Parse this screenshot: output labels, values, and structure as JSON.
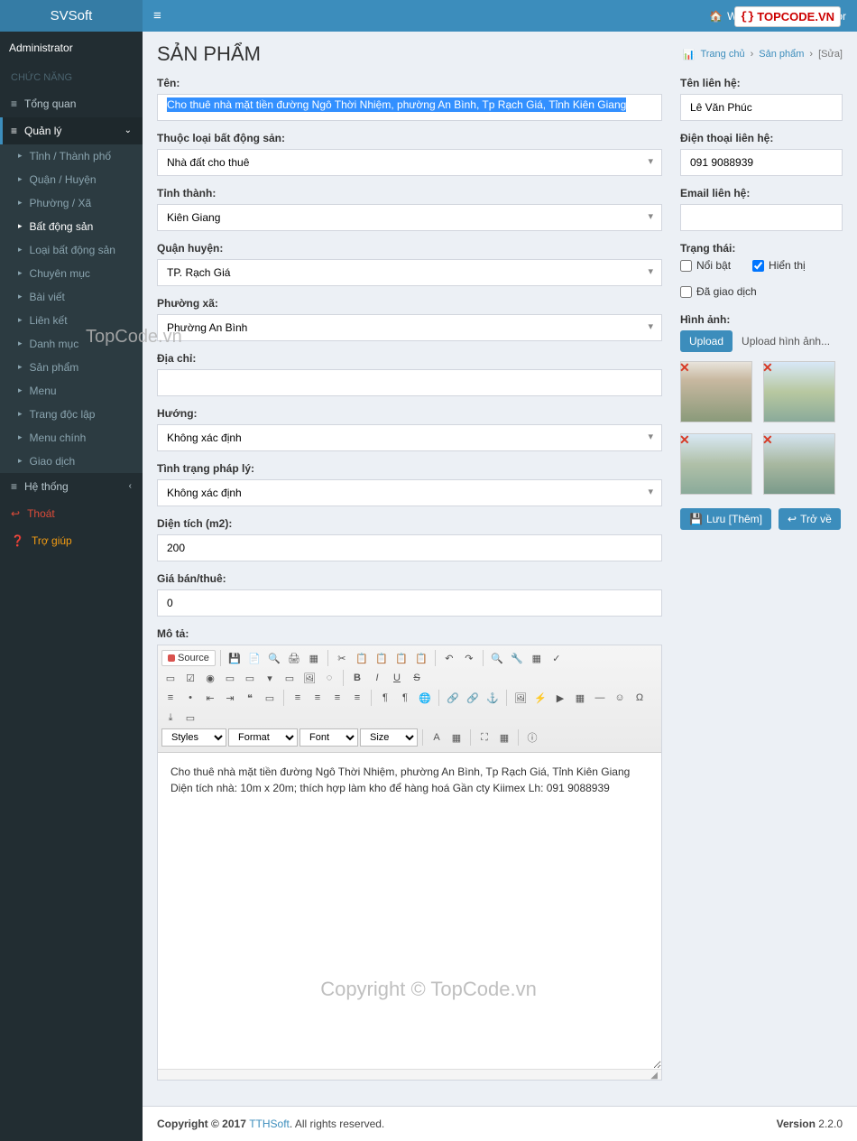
{
  "brand": "SVSoft",
  "header": {
    "website": "Website",
    "user": "Administrator"
  },
  "user_panel": {
    "name": "Administrator"
  },
  "sidebar": {
    "section": "CHỨC NĂNG",
    "overview": "Tổng quan",
    "manage": "Quản lý",
    "tree": {
      "tinh": "Tỉnh / Thành phố",
      "quan": "Quận / Huyện",
      "phuong": "Phường / Xã",
      "bds": "Bất động sản",
      "loaibds": "Loại bất động sản",
      "chuyenmuc": "Chuyên mục",
      "baiviet": "Bài viết",
      "lienket": "Liên kết",
      "danhmuc": "Danh mục",
      "sanpham": "Sản phẩm",
      "menu": "Menu",
      "trangdoclap": "Trang độc lập",
      "menuchinh": "Menu chính",
      "giaodich": "Giao dịch"
    },
    "system": "Hệ thống",
    "logout": "Thoát",
    "help": "Trợ giúp"
  },
  "page": {
    "title": "SẢN PHẨM",
    "breadcrumb": {
      "home": "Trang chủ",
      "sp": "Sản phẩm",
      "edit": "[Sửa]"
    }
  },
  "form": {
    "ten_label": "Tên:",
    "ten_value": "Cho thuê nhà mặt tiền đường Ngô Thời Nhiệm, phường An Bình, Tp Rạch Giá, Tỉnh Kiên Giang",
    "loai_label": "Thuộc loại bất động sản:",
    "loai_value": "Nhà đất cho thuê",
    "tinh_label": "Tỉnh thành:",
    "tinh_value": "Kiên Giang",
    "quan_label": "Quận huyện:",
    "quan_value": "TP. Rạch Giá",
    "phuong_label": "Phường xã:",
    "phuong_value": "Phường An Bình",
    "diachi_label": "Địa chỉ:",
    "diachi_value": "",
    "huong_label": "Hướng:",
    "huong_value": "Không xác định",
    "phaply_label": "Tình trạng pháp lý:",
    "phaply_value": "Không xác định",
    "dientich_label": "Diện tích (m2):",
    "dientich_value": "200",
    "gia_label": "Giá bán/thuê:",
    "gia_value": "0",
    "mota_label": "Mô tả:"
  },
  "contact": {
    "ten_label": "Tên liên hệ:",
    "ten_value": "Lê Văn Phúc",
    "dt_label": "Điện thoại liên hệ:",
    "dt_value": "091 9088939",
    "email_label": "Email liên hệ:",
    "email_value": "",
    "trangthai_label": "Trạng thái:",
    "noibat": "Nổi bật",
    "hienthi": "Hiển thị",
    "dagiaodich": "Đã giao dịch",
    "hinhanh_label": "Hình ảnh:",
    "upload": "Upload",
    "upload_hint": "Upload hình ảnh...",
    "luu": "Lưu [Thêm]",
    "trove": "Trở về"
  },
  "editor": {
    "source": "Source",
    "styles": "Styles",
    "format": "Format",
    "font": "Font",
    "size": "Size",
    "body": "Cho thuê nhà mặt tiền đường Ngô Thời Nhiệm, phường An Bình, Tp Rạch Giá, Tỉnh Kiên Giang Diện tích nhà: 10m x 20m; thích hợp làm kho để hàng hoá Gần cty Kiimex Lh: 091 9088939"
  },
  "footer": {
    "copyright": "Copyright © 2017 ",
    "company": "TTHSoft",
    "rights": " All rights reserved.",
    "version_label": "Version",
    "version": " 2.2.0"
  },
  "watermark": {
    "top": "TOPCODE.VN",
    "center": "TopCode.vn",
    "bottom": "Copyright © TopCode.vn"
  }
}
